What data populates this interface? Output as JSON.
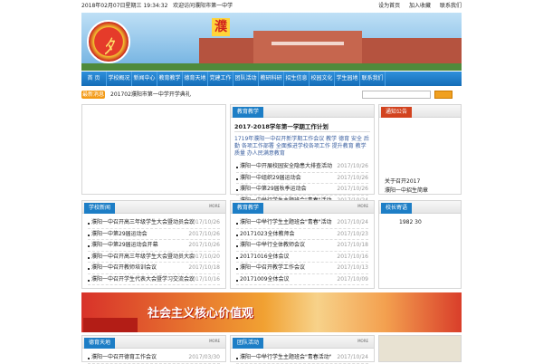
{
  "top": {
    "date": "2018年02月07日星期三 19:34:32",
    "welcome": "欢迎访问濮阳市第一中学",
    "links": [
      "设为首页",
      "加入收藏",
      "联系我们"
    ]
  },
  "banner": {
    "char": "濮"
  },
  "nav": [
    "首 页",
    "学校概况",
    "新闻中心",
    "教育教学",
    "德育天地",
    "党建工作",
    "团队活动",
    "教研科研",
    "招生信息",
    "校园文化",
    "学生园地",
    "联系我们"
  ],
  "ticker": {
    "label": "最新消息",
    "text": "201702濮阳市第一中学开学典礼"
  },
  "feature": {
    "title": "2017-2018学年第一学期工作计划",
    "summary": "1719年濮阳一中召开新学期工作会议 教学 德育 安全 后勤 各项工作部署 全面推进学校各项工作 提升教育 教学质量 办人民满意教育",
    "items": [
      {
        "t": "濮阳一中开展校园安全隐患大排查活动",
        "d": "2017/10/26"
      },
      {
        "t": "濮阳一中组织29届运动会",
        "d": "2017/10/26"
      },
      {
        "t": "濮阳一中第29届秋季运动会",
        "d": "2017/10/26"
      },
      {
        "t": "濮阳一中举行学生主题班会\"青春\"活动",
        "d": "2017/10/24"
      }
    ]
  },
  "notice": {
    "title": "通知公告",
    "items": [
      "关于召开2017",
      "濮阳一中招生简章"
    ]
  },
  "news1": {
    "title": "学校新闻",
    "more": "MORE",
    "items": [
      {
        "t": "濮阳一中召开高三年级学生大会暨动员会议",
        "d": "2017/10/26"
      },
      {
        "t": "濮阳一中第29届运动会",
        "d": "2017/10/26"
      },
      {
        "t": "濮阳一中第29届运动会开幕",
        "d": "2017/10/26"
      },
      {
        "t": "濮阳一中召开高三年级学生大会暨动员大会",
        "d": "2017/10/20"
      },
      {
        "t": "濮阳一中召开教师培训会议",
        "d": "2017/10/18"
      },
      {
        "t": "濮阳一中召开学生代表大会暨学习交流会议",
        "d": "2017/10/16"
      }
    ]
  },
  "news2": {
    "title": "教育教学",
    "more": "MORE",
    "items": [
      {
        "t": "濮阳一中举行学生主题班会\"青春\"活动",
        "d": "2017/10/24"
      },
      {
        "t": "20171023全体教师会",
        "d": "2017/10/23"
      },
      {
        "t": "濮阳一中举行全体教师会议",
        "d": "2017/10/18"
      },
      {
        "t": "20171016全体会议",
        "d": "2017/10/16"
      },
      {
        "t": "濮阳一中召开教学工作会议",
        "d": "2017/10/13"
      },
      {
        "t": "20171009全体会议",
        "d": "2017/10/09"
      }
    ]
  },
  "side2": {
    "title": "校长寄语",
    "text": "1982   30"
  },
  "slogan": "社会主义核心价值观",
  "news3": {
    "title": "德育天地",
    "more": "MORE",
    "items": [
      {
        "t": "濮阳一中召开德育工作会议",
        "d": "2017/03/30"
      }
    ]
  },
  "news4": {
    "title": "团队活动",
    "more": "MORE",
    "items": [
      {
        "t": "濮阳一中举行学生主题班会\"青春活动\"",
        "d": "2017/10/24"
      }
    ]
  }
}
